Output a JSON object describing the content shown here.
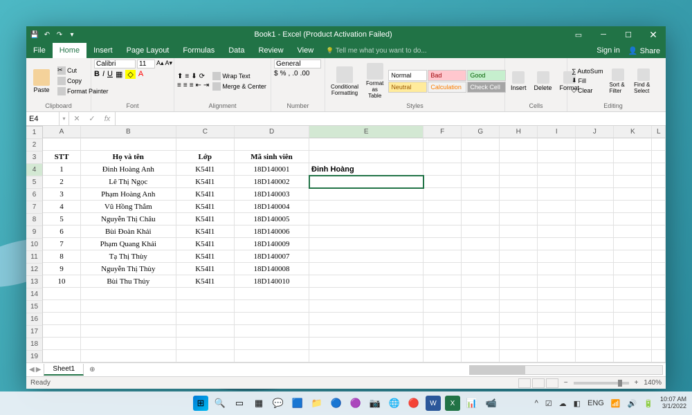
{
  "window": {
    "title": "Book1 - Excel (Product Activation Failed)"
  },
  "menubar": {
    "items": [
      "File",
      "Home",
      "Insert",
      "Page Layout",
      "Formulas",
      "Data",
      "Review",
      "View"
    ],
    "active": "Home",
    "tell_me": "Tell me what you want to do...",
    "sign_in": "Sign in",
    "share": "Share"
  },
  "ribbon": {
    "clipboard": {
      "label": "Clipboard",
      "paste": "Paste",
      "cut": "Cut",
      "copy": "Copy",
      "format_painter": "Format Painter"
    },
    "font": {
      "label": "Font",
      "name": "Calibri",
      "size": "11"
    },
    "alignment": {
      "label": "Alignment",
      "wrap": "Wrap Text",
      "merge": "Merge & Center"
    },
    "number": {
      "label": "Number",
      "format": "General"
    },
    "styles": {
      "label": "Styles",
      "conditional": "Conditional Formatting",
      "format_as": "Format as Table",
      "normal": "Normal",
      "bad": "Bad",
      "good": "Good",
      "neutral": "Neutral",
      "calculation": "Calculation",
      "check": "Check Cell"
    },
    "cells": {
      "label": "Cells",
      "insert": "Insert",
      "delete": "Delete",
      "format": "Format"
    },
    "editing": {
      "label": "Editing",
      "autosum": "AutoSum",
      "fill": "Fill",
      "clear": "Clear",
      "sort": "Sort & Filter",
      "find": "Find & Select"
    }
  },
  "formula_bar": {
    "name_box": "E4",
    "formula": ""
  },
  "columns": [
    "A",
    "B",
    "C",
    "D",
    "E",
    "F",
    "G",
    "H",
    "I",
    "J",
    "K",
    "L"
  ],
  "active_cell": "E4",
  "headers": {
    "stt": "STT",
    "name": "Họ và tên",
    "class": "Lớp",
    "sid": "Mã sinh viên"
  },
  "rows": [
    {
      "stt": "1",
      "name": "Đinh Hoàng Anh",
      "class": "K54I1",
      "sid": "18D140001"
    },
    {
      "stt": "2",
      "name": "Lê Thị Ngọc",
      "class": "K54I1",
      "sid": "18D140002"
    },
    {
      "stt": "3",
      "name": "Phạm Hoàng Anh",
      "class": "K54I1",
      "sid": "18D140003"
    },
    {
      "stt": "4",
      "name": "Vũ Hồng Thắm",
      "class": "K54I1",
      "sid": "18D140004"
    },
    {
      "stt": "5",
      "name": "Nguyễn Thị Châu",
      "class": "K54I1",
      "sid": "18D140005"
    },
    {
      "stt": "6",
      "name": "Bùi Đoàn Khải",
      "class": "K54I1",
      "sid": "18D140006"
    },
    {
      "stt": "7",
      "name": "Phạm Quang Khải",
      "class": "K54I1",
      "sid": "18D140009"
    },
    {
      "stt": "8",
      "name": "Tạ Thị Thùy",
      "class": "K54I1",
      "sid": "18D140007"
    },
    {
      "stt": "9",
      "name": "Nguyễn Thị Thùy",
      "class": "K54I1",
      "sid": "18D140008"
    },
    {
      "stt": "10",
      "name": "Bùi Thu Thủy",
      "class": "K54I1",
      "sid": "18D140010"
    }
  ],
  "e3_value": "Đinh Hoàng",
  "sheet_tabs": {
    "sheet1": "Sheet1"
  },
  "statusbar": {
    "ready": "Ready",
    "zoom": "140%"
  },
  "taskbar": {
    "time": "10:07 AM",
    "date": "3/1/2022",
    "lang": "ENG"
  }
}
